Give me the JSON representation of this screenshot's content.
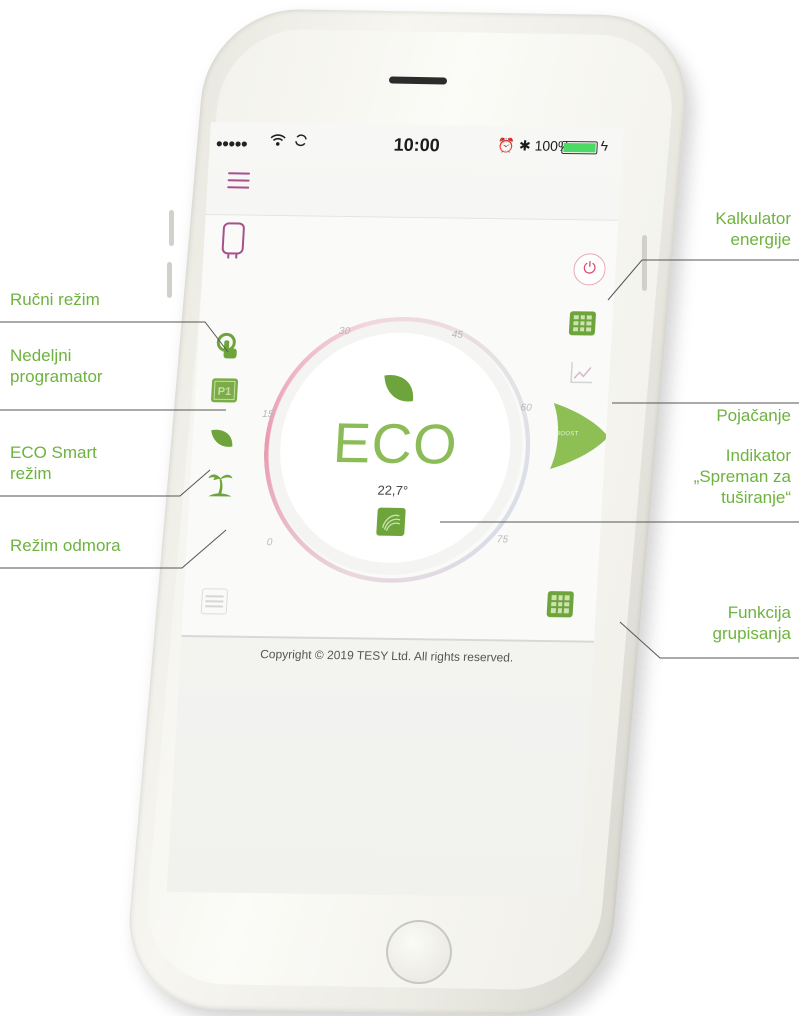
{
  "status_bar": {
    "signal": "●●●●●",
    "time": "10:00",
    "battery_percent": "100%"
  },
  "dial": {
    "mode_text": "ECO",
    "temperature": "22,7°",
    "tick_labels": [
      "0",
      "15",
      "30",
      "45",
      "60",
      "75"
    ]
  },
  "boost_label": "BOOST",
  "footer": {
    "copyright": "Copyright © 2019 TESY Ltd. All rights reserved."
  },
  "callouts": {
    "manual_mode": "Ručni režim",
    "weekly_programmer": "Nedeljni programator",
    "eco_smart": "ECO Smart režim",
    "holiday_mode": "Režim odmora",
    "energy_calculator": "Kalkulator energije",
    "boost": "Pojačanje",
    "shower_ready": "Indikator „Spreman za tuširanje“",
    "grouping": "Funkcija grupisanja"
  },
  "colors": {
    "accent_green": "#6ea43c",
    "eco_text": "#8bbc57",
    "callout_text": "#6eb33f",
    "menu_magenta": "#a9508a",
    "power_red": "#d94b68"
  },
  "icons": {
    "menu": "hamburger-menu-icon",
    "boiler": "water-heater-icon",
    "power": "power-icon",
    "calculator": "calculator-icon",
    "chart": "line-chart-icon",
    "manual": "hand-pointer-icon",
    "program": "p1-program-icon",
    "eco": "leaf-icon",
    "holiday": "palm-tree-icon",
    "settings": "sliders-icon",
    "shower": "shower-ready-icon",
    "group": "grouping-icon"
  }
}
